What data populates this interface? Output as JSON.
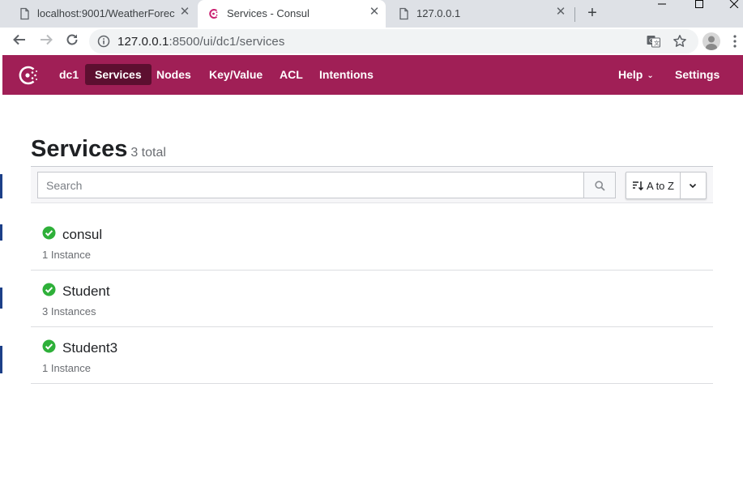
{
  "browser": {
    "tabs": [
      {
        "title": "localhost:9001/WeatherForec",
        "active": false,
        "icon": "page-icon"
      },
      {
        "title": "Services - Consul",
        "active": true,
        "icon": "consul-favicon-icon"
      },
      {
        "title": "127.0.0.1",
        "active": false,
        "icon": "page-icon"
      }
    ],
    "url_host": "127.0.0.1",
    "url_path": ":8500/ui/dc1/services"
  },
  "nav": {
    "datacenter": "dc1",
    "items": [
      {
        "label": "Services",
        "active": true
      },
      {
        "label": "Nodes",
        "active": false
      },
      {
        "label": "Key/Value",
        "active": false
      },
      {
        "label": "ACL",
        "active": false
      },
      {
        "label": "Intentions",
        "active": false
      }
    ],
    "help_label": "Help",
    "settings_label": "Settings",
    "brand_color": "#a01f56",
    "active_color": "#5d0f30"
  },
  "page": {
    "title": "Services",
    "total": "3 total",
    "search_placeholder": "Search",
    "sort_label": "A to Z"
  },
  "services": [
    {
      "name": "consul",
      "instances": "1 Instance",
      "status": "passing"
    },
    {
      "name": "Student",
      "instances": "3 Instances",
      "status": "passing"
    },
    {
      "name": "Student3",
      "instances": "1 Instance",
      "status": "passing"
    }
  ],
  "colors": {
    "passing": "#2eb039"
  }
}
